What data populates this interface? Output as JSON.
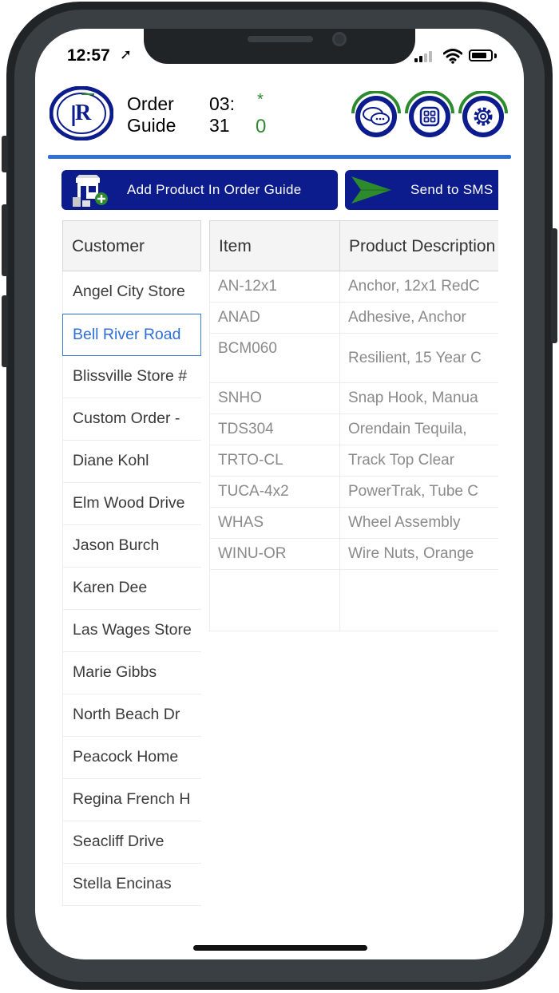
{
  "status_bar": {
    "time": "12:57",
    "location_arrow": "➚"
  },
  "header": {
    "title_line1": "Order",
    "title_line2": "Guide",
    "timer_line1": "03:",
    "timer_line2": "31",
    "indicator_star": "*",
    "indicator_count": "0",
    "icons": [
      "chat-icon",
      "grid-apps-icon",
      "settings-gear-icon"
    ]
  },
  "actions": {
    "add_product_label": "Add Product In Order Guide",
    "send_sms_label": "Send to SMS"
  },
  "customers": {
    "header": "Customer",
    "selected_index": 1,
    "items": [
      "Angel City Store",
      "Bell River Road",
      "Blissville Store #",
      "Custom Order - ",
      "Diane Kohl",
      "Elm Wood Drive",
      "Jason Burch",
      "Karen Dee",
      "Las Wages Store",
      "Marie Gibbs",
      "North Beach Dr",
      "Peacock Home",
      "Regina French H",
      "Seacliff Drive",
      "Stella Encinas"
    ]
  },
  "items_table": {
    "columns": [
      "Item",
      "Product Description"
    ],
    "rows": [
      [
        "AN-12x1",
        "Anchor, 12x1 RedC"
      ],
      [
        "ANAD",
        "Adhesive, Anchor"
      ],
      [
        "BCM060",
        "Resilient, 15 Year C"
      ],
      [
        "SNHO",
        "Snap Hook, Manua"
      ],
      [
        "TDS304",
        "Orendain Tequila,"
      ],
      [
        "TRTO-CL",
        "Track Top Clear"
      ],
      [
        "TUCA-4x2",
        "PowerTrak, Tube C"
      ],
      [
        "WHAS",
        "Wheel Assembly"
      ],
      [
        "WINU-OR",
        "Wire Nuts, Orange"
      ]
    ]
  },
  "colors": {
    "brand_navy": "#0c1c8c",
    "accent_blue": "#2f6fd6",
    "green": "#2d8a2d"
  }
}
